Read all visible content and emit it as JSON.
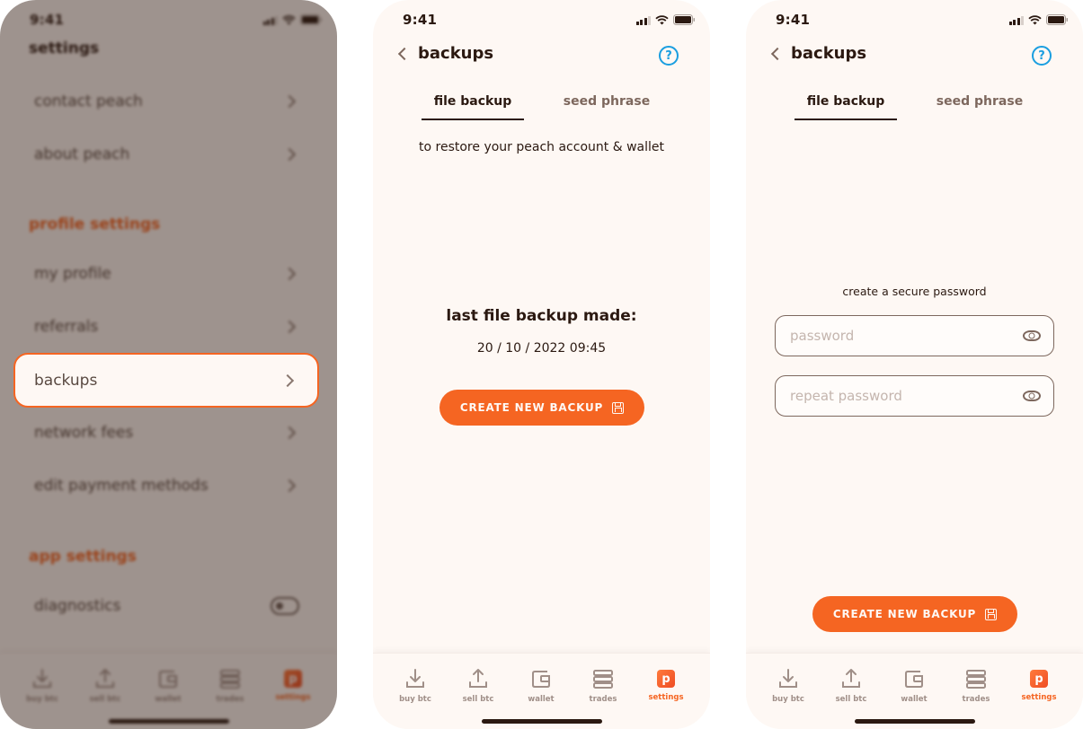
{
  "status_bar": {
    "time": "9:41"
  },
  "screen1": {
    "title": "settings",
    "items_top": [
      {
        "label": "contact peach"
      },
      {
        "label": "about peach"
      }
    ],
    "sections": [
      {
        "title": "profile settings"
      },
      {
        "title": "app settings"
      }
    ],
    "profile_items": [
      {
        "label": "my profile"
      },
      {
        "label": "referrals"
      },
      {
        "label": "backups",
        "highlighted": true
      },
      {
        "label": "network fees"
      },
      {
        "label": "edit payment methods"
      }
    ],
    "app_items": [
      {
        "label": "diagnostics",
        "toggle": false
      }
    ]
  },
  "screen2": {
    "header": {
      "title": "backups",
      "back_icon": "chevron-left-icon",
      "help_icon": "question-circle-icon"
    },
    "tabs": [
      {
        "label": "file backup",
        "active": true
      },
      {
        "label": "seed phrase",
        "active": false
      }
    ],
    "subtitle": "to restore your peach account & wallet",
    "last_backup_title": "last file backup made:",
    "last_backup_date": "20 / 10 / 2022 09:45",
    "button_label": "CREATE NEW BACKUP",
    "button_icon": "save-icon"
  },
  "screen3": {
    "header": {
      "title": "backups",
      "back_icon": "chevron-left-icon",
      "help_icon": "question-circle-icon"
    },
    "tabs": [
      {
        "label": "file backup",
        "active": true
      },
      {
        "label": "seed phrase",
        "active": false
      }
    ],
    "password_label": "create a secure password",
    "password_placeholder": "password",
    "repeat_placeholder": "repeat password",
    "button_label": "CREATE NEW BACKUP",
    "button_icon": "save-icon"
  },
  "navbar": {
    "items": [
      {
        "label": "buy btc",
        "icon": "download-icon"
      },
      {
        "label": "sell btc",
        "icon": "upload-icon"
      },
      {
        "label": "wallet",
        "icon": "wallet-icon"
      },
      {
        "label": "trades",
        "icon": "list-icon"
      },
      {
        "label": "settings",
        "icon": "peach-logo-icon",
        "active": true
      }
    ],
    "settings_glyph": "p"
  },
  "colors": {
    "accent": "#f56522",
    "background": "#fef8f4",
    "text": "#2b1911",
    "muted": "#7d675d",
    "help": "#1a9ee0"
  }
}
